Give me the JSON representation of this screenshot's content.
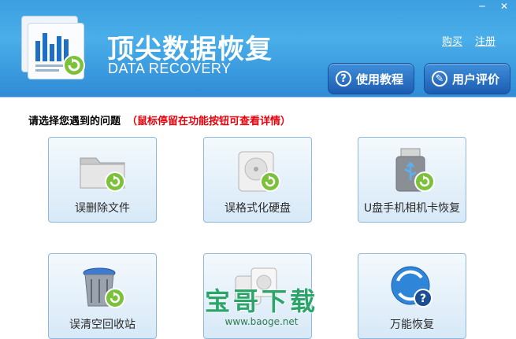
{
  "window": {
    "minimize": "─",
    "close": "✕"
  },
  "app": {
    "title": "顶尖数据恢复",
    "subtitle": "DATA RECOVERY"
  },
  "links": {
    "buy": "购买",
    "register": "注册"
  },
  "buttons": {
    "tutorial": {
      "label": "使用教程",
      "icon": "question-icon"
    },
    "review": {
      "label": "用户评价",
      "icon": "chat-icon"
    }
  },
  "prompt": {
    "text": "请选择您遇到的问题",
    "hint": "（鼠标停留在功能按钮可查看详情）"
  },
  "tiles": [
    {
      "label": "误删除文件",
      "icon": "folder-recover-icon"
    },
    {
      "label": "误格式化硬盘",
      "icon": "harddisk-recover-icon"
    },
    {
      "label": "U盘手机相机卡恢复",
      "icon": "usb-recover-icon"
    },
    {
      "label": "误清空回收站",
      "icon": "recycle-bin-recover-icon"
    },
    {
      "label": "",
      "icon": "partition-recover-icon"
    },
    {
      "label": "万能恢复",
      "icon": "universal-recover-icon"
    }
  ],
  "watermark": {
    "text": "宝哥下载",
    "url": "www.baoge.net"
  },
  "colors": {
    "header": "#3d9fe0",
    "accent_button": "#1c5cb2",
    "hint": "#e8000b",
    "recover_arrow": "#7cc13a"
  }
}
